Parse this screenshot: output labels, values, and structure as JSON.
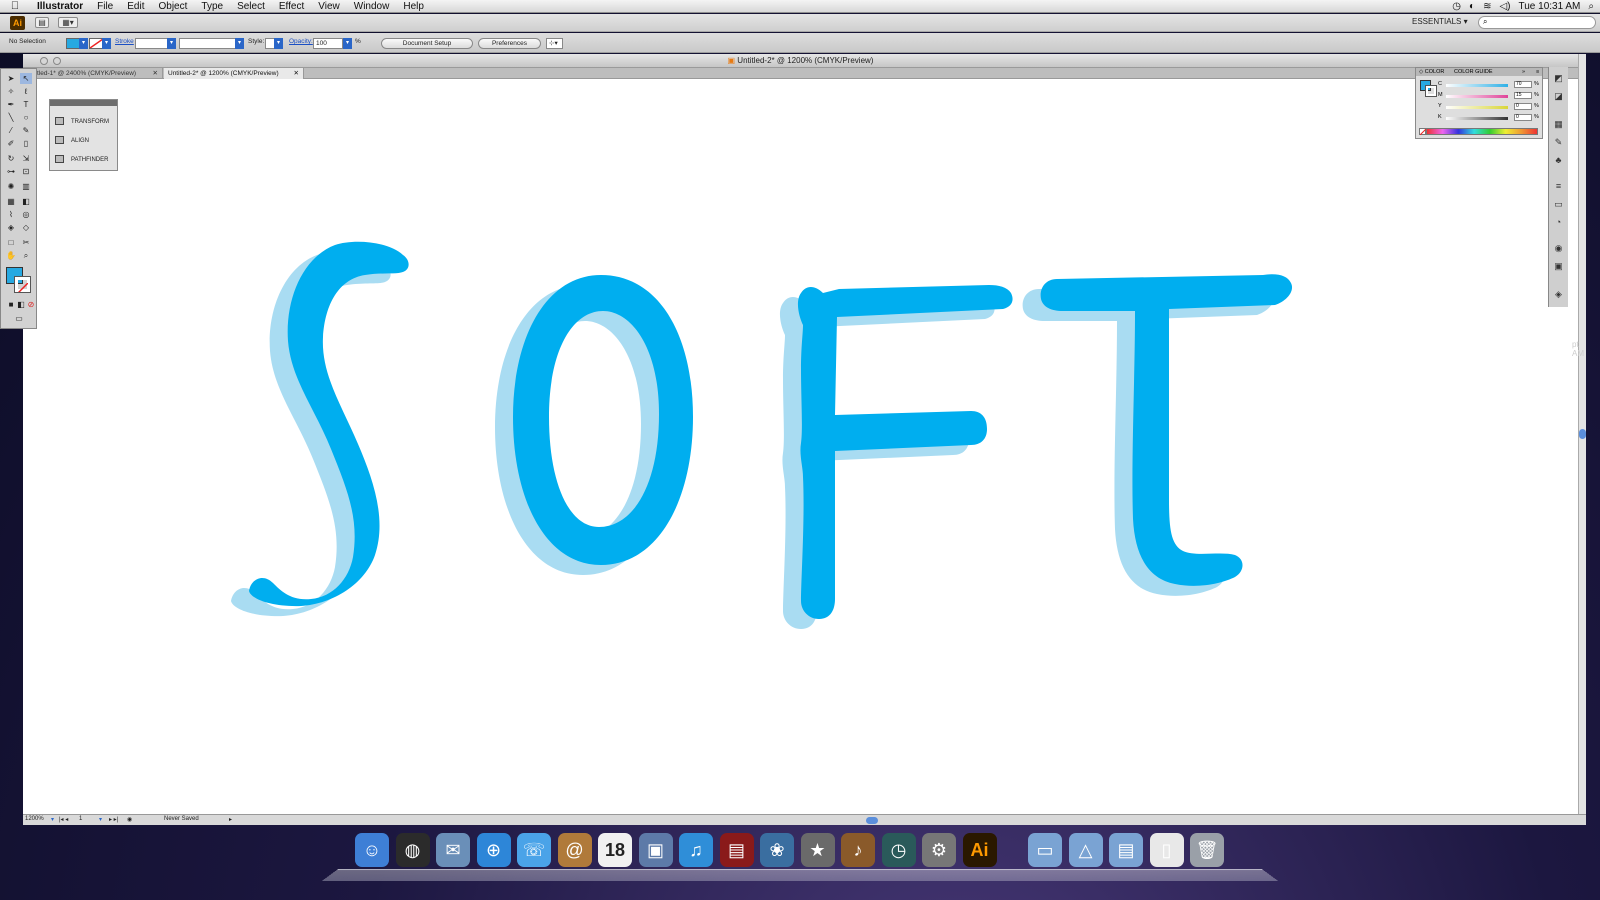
{
  "menubar": {
    "app_name": "Illustrator",
    "items": [
      "File",
      "Edit",
      "Object",
      "Type",
      "Select",
      "Effect",
      "View",
      "Window",
      "Help"
    ],
    "clock": "Tue 10:31 AM"
  },
  "appbar": {
    "logo": "Ai",
    "workspace": "ESSENTIALS ▾"
  },
  "control": {
    "selection": "No Selection",
    "stroke_label": "Stroke",
    "style_label": "Style:",
    "opacity_label": "Opacity:",
    "opacity_value": "100",
    "percent": "%",
    "document_setup": "Document Setup",
    "preferences": "Preferences",
    "fill_color": "#27a9e1"
  },
  "window": {
    "title": "Untitled-2* @ 1200% (CMYK/Preview)",
    "tabs": [
      {
        "label": "tled-1* @ 2400% (CMYK/Preview)",
        "close": "✕"
      },
      {
        "label": "Untitled-2* @ 1200% (CMYK/Preview)",
        "close": "✕"
      }
    ]
  },
  "panels": {
    "mini": [
      "TRANSFORM",
      "ALIGN",
      "PATHFINDER"
    ],
    "color": {
      "tab_color": "◇ COLOR",
      "tab_guide": "COLOR GUIDE",
      "rows": [
        {
          "label": "C",
          "value": "70",
          "color": "#2fb0e6"
        },
        {
          "label": "M",
          "value": "15",
          "color": "#e0449a"
        },
        {
          "label": "Y",
          "value": "0",
          "color": "#d9d63a"
        },
        {
          "label": "K",
          "value": "0",
          "color": "#333333"
        }
      ],
      "pct": "%"
    }
  },
  "status": {
    "zoom": "1200%",
    "page": "1",
    "save_state": "Never Saved"
  },
  "artwork": {
    "fill": "#00aeef",
    "shadow": "#a9dcf2",
    "text": "SOFT"
  },
  "desktop": {
    "clock_fragment_1": "pt",
    "clock_fragment_2": "AM"
  },
  "dock": {
    "calendar_day": "18",
    "items": [
      "finder-icon",
      "dashboard-icon",
      "mail-icon",
      "safari-icon",
      "ichat-icon",
      "address-book-icon",
      "ical-icon",
      "preview-icon",
      "itunes-icon",
      "front-row-icon",
      "iphoto-icon",
      "imovie-icon",
      "garageband-icon",
      "time-machine-icon",
      "system-preferences-icon",
      "illustrator-icon",
      "folder-icon",
      "applications-folder-icon",
      "documents-folder-icon",
      "pdf-document-icon",
      "trash-icon"
    ]
  }
}
